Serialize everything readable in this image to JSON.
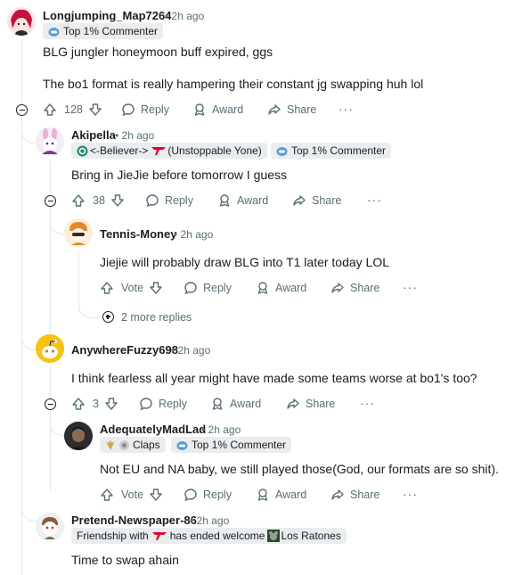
{
  "comments": [
    {
      "author": "Longjumping_Map7264",
      "time": "• 2h ago",
      "flair": "Top 1% Commenter",
      "body": [
        "BLG jungler honeymoon buff expired, ggs",
        "The bo1 format is really hampering their constant jg swapping huh lol"
      ],
      "votes": "128"
    },
    {
      "author": "Akipella",
      "time": "• 2h ago",
      "flair_user": "<-Believer->",
      "flair_user_tail": "(Unstoppable Yone)",
      "flair": "Top 1% Commenter",
      "body": [
        "Bring in JieJie before tomorrow I guess"
      ],
      "votes": "38"
    },
    {
      "author": "Tennis-Money",
      "time": "• 2h ago",
      "body": [
        "Jiejie will probably draw BLG into T1 later today LOL"
      ],
      "votes": "Vote",
      "more_replies": "2 more replies"
    },
    {
      "author": "AnywhereFuzzy698",
      "time": "• 2h ago",
      "body": [
        "I think fearless all year might have made some teams worse at bo1's too?"
      ],
      "votes": "3"
    },
    {
      "author": "AdequatelyMadLad",
      "time": "• 2h ago",
      "flair_user": "Claps",
      "flair": "Top 1% Commenter",
      "body": [
        "Not EU and NA baby, we still played those(God, our formats are so shit)."
      ],
      "votes": "Vote"
    },
    {
      "author": "Pretend-Newspaper-86",
      "time": "• 2h ago",
      "flair_user": "Friendship with",
      "flair_user_mid": "has ended welcome",
      "flair_user_tail": "Los Ratones",
      "body": [
        "Time to swap ahain"
      ]
    }
  ],
  "actions": {
    "reply": "Reply",
    "award": "Award",
    "share": "Share",
    "overflow": "···"
  },
  "colors": {
    "text": "#1c1c1c",
    "meta": "#576f76",
    "flair_bg": "#eaedef",
    "thread_line": "#e5e8ea",
    "t1_red": "#e2012d"
  }
}
